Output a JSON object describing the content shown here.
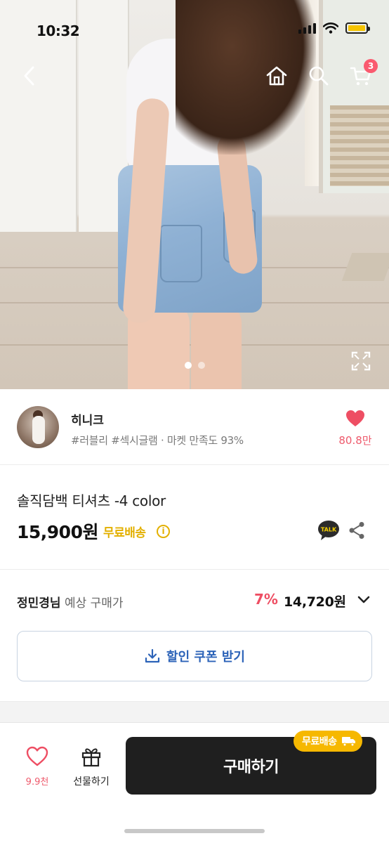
{
  "status_bar": {
    "time": "10:32",
    "battery_color": "#f5c400"
  },
  "nav": {
    "back_icon": "chevron-left-icon",
    "home_icon": "home-icon",
    "search_icon": "search-icon",
    "cart_icon": "cart-icon",
    "cart_count": "3"
  },
  "gallery": {
    "image_count": 2,
    "active_index": 0,
    "expand_icon": "expand-icon"
  },
  "seller": {
    "name": "히니크",
    "tags": "#러블리 #섹시글램 · 마켓 만족도 93%",
    "like_count": "80.8만",
    "like_icon": "heart-icon"
  },
  "product": {
    "name": "솔직담백 티셔츠 -4 color",
    "price": "15,900원",
    "shipping": "무료배송",
    "info_icon": "info-icon",
    "talk_icon": "talk-icon",
    "talk_label": "TALK",
    "share_icon": "share-icon"
  },
  "member_price": {
    "user_name": "정민경님",
    "label": "예상 구매가",
    "discount": "7%",
    "price": "14,720원",
    "chevron_icon": "chevron-down-icon"
  },
  "coupon": {
    "label": "할인 쿠폰 받기",
    "icon": "download-icon"
  },
  "bottom_bar": {
    "wish_count": "9.9천",
    "gift_label": "선물하기",
    "buy_label": "구매하기",
    "ship_badge": "무료배송",
    "ship_badge_icon": "truck-icon"
  },
  "colors": {
    "accent_pink": "#ee5a6c",
    "coupon_blue": "#2c63b8",
    "shipping_yellow": "#e3b000",
    "buy_button": "#1f1f1f"
  }
}
